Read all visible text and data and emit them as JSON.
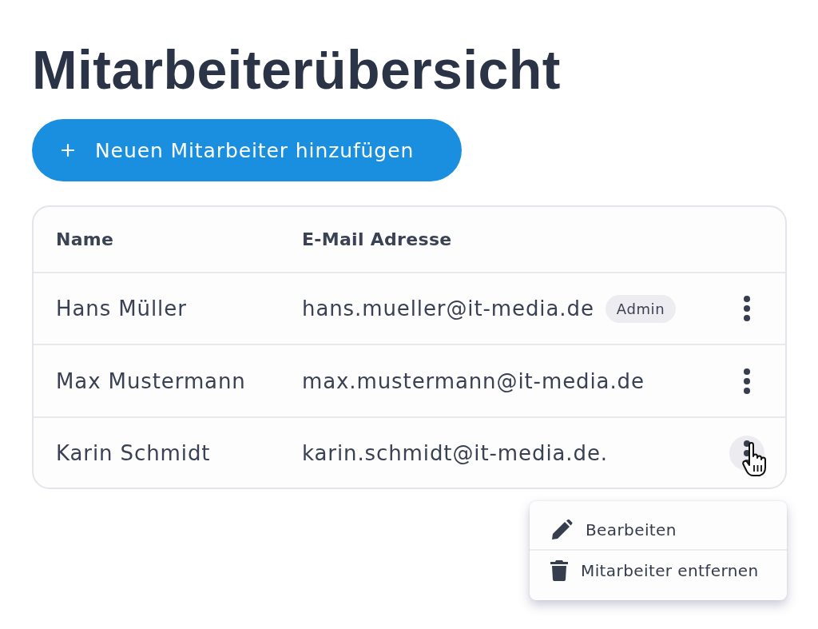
{
  "title": "Mitarbeiterübersicht",
  "add_button": {
    "label": "Neuen Mitarbeiter hinzufügen"
  },
  "table": {
    "columns": [
      "Name",
      "E-Mail Adresse"
    ],
    "rows": [
      {
        "name": "Hans Müller",
        "email": "hans.mueller@it-media.de",
        "badge": "Admin",
        "hovered": false
      },
      {
        "name": "Max Mustermann",
        "email": "max.mustermann@it-media.de",
        "hovered": false
      },
      {
        "name": "Karin Schmidt",
        "email": "karin.schmidt@it-media.de.",
        "hovered": true
      }
    ]
  },
  "context_menu": {
    "items": [
      {
        "kind": "edit",
        "label": "Bearbeiten"
      },
      {
        "kind": "delete",
        "label": "Mitarbeiter entfernen"
      }
    ]
  }
}
